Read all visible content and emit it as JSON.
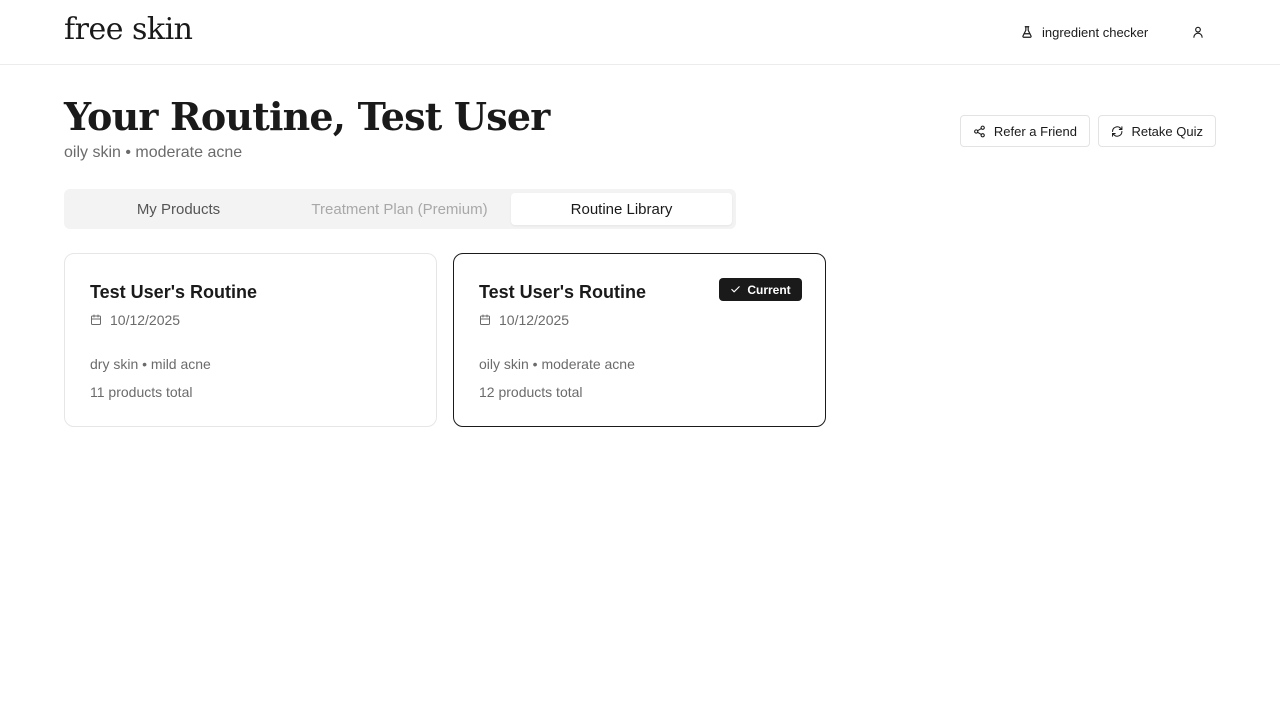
{
  "header": {
    "logo": "free skin",
    "nav_label": "ingredient checker",
    "nav_icon": "flask-icon",
    "user_icon": "user-icon"
  },
  "page": {
    "title": "Your Routine, Test User",
    "subtitle": "oily skin • moderate acne"
  },
  "actions": {
    "refer_label": "Refer a Friend",
    "retake_label": "Retake Quiz"
  },
  "tabs": [
    {
      "label": "My Products",
      "state": "inactive"
    },
    {
      "label": "Treatment Plan (Premium)",
      "state": "disabled"
    },
    {
      "label": "Routine Library",
      "state": "active"
    }
  ],
  "routines": [
    {
      "title": "Test User's Routine",
      "date": "10/12/2025",
      "skin": "dry skin • mild acne",
      "count": "11 products total",
      "current": false
    },
    {
      "title": "Test User's Routine",
      "date": "10/12/2025",
      "skin": "oily skin • moderate acne",
      "count": "12 products total",
      "current": true,
      "badge": "Current"
    }
  ],
  "colors": {
    "text": "#1a1a1a",
    "muted": "#6b6b6b",
    "border": "#e6e6e6",
    "tab_bg": "#f3f3f3",
    "badge_bg": "#1a1a1a"
  }
}
